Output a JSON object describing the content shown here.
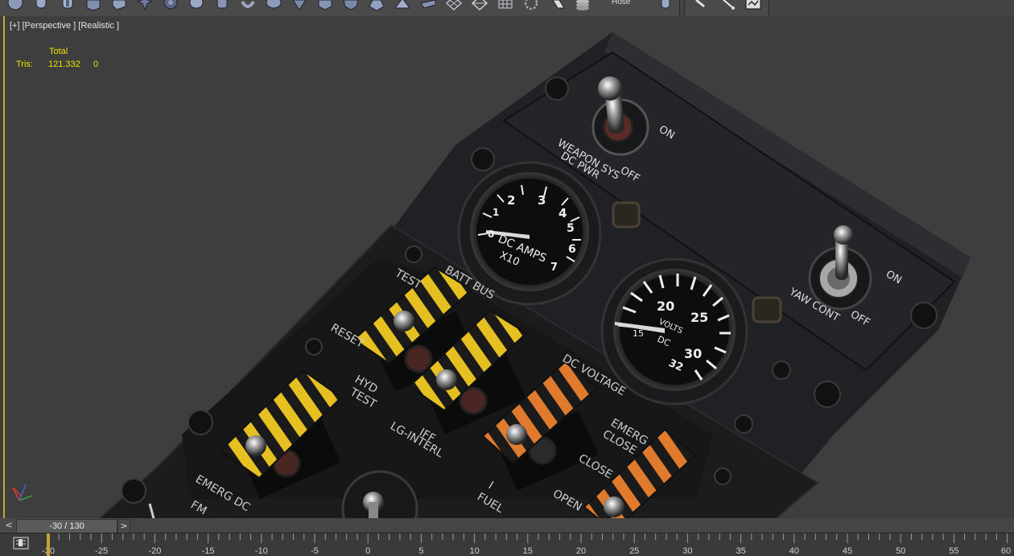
{
  "toolbar": {
    "buttons": [
      {
        "icon": "sphere-icon"
      },
      {
        "icon": "cylinder-icon"
      },
      {
        "icon": "tube-icon"
      },
      {
        "icon": "box-icon"
      },
      {
        "icon": "wedge-icon"
      },
      {
        "icon": "star-icon"
      },
      {
        "icon": "torus-knot-icon"
      },
      {
        "icon": "capsule-icon"
      },
      {
        "icon": "spring-icon"
      },
      {
        "icon": "torus-icon"
      },
      {
        "icon": "spindle-icon"
      },
      {
        "icon": "prism-icon"
      },
      {
        "icon": "hedra-icon"
      },
      {
        "icon": "gengon-icon"
      },
      {
        "icon": "cone-icon"
      },
      {
        "icon": "plane-icon"
      },
      {
        "icon": "geosphere-icon"
      },
      {
        "icon": "lattice-icon"
      },
      {
        "icon": "grid-icon"
      },
      {
        "icon": "gear-icon"
      },
      {
        "icon": "paint-icon"
      },
      {
        "icon": "layers-icon"
      }
    ],
    "hose_label": "Hose",
    "extra_buttons": [
      {
        "icon": "pin-icon"
      },
      {
        "icon": "select-icon"
      },
      {
        "icon": "wand-icon"
      },
      {
        "icon": "snapshot-icon"
      }
    ]
  },
  "viewport": {
    "label": "[+] [Perspective ] [Realistic ]",
    "stats": {
      "header": "Total",
      "tris_label": "Tris:",
      "tris_value": "121.332",
      "tris_sel": "0"
    }
  },
  "panel_text": {
    "weapon_on": "ON",
    "weapon_off": "OFF",
    "weapon_label1": "WEAPON SYS",
    "weapon_label2": "DC PWR",
    "amps_label": "DC AMPS",
    "amps_x10": "X10",
    "amps_ticks": [
      "0",
      "1",
      "2",
      "3",
      "4",
      "5",
      "6",
      "7"
    ],
    "volts_label": "VOLTS",
    "volts_dc": "DC",
    "volts_ticks": [
      "15",
      "20",
      "25",
      "30",
      "32"
    ],
    "yaw_on": "ON",
    "yaw_off": "OFF",
    "yaw_label": "YAW CONT",
    "test": "TEST",
    "batt_bus": "BATT BUS",
    "reset": "RESET",
    "hyd": "HYD",
    "hyd_test": "TEST",
    "iff": "IFF",
    "lg_interl": "LG-INTERL",
    "dc_voltage": "DC VOLTAGE",
    "emerg": "EMERG",
    "close": "CLOSE",
    "close2": "CLOSE",
    "open": "OPEN",
    "fuel": "FUEL",
    "fuel_i": "I",
    "emerg_dc": "EMERG DC",
    "fm": "FM"
  },
  "timeslider": {
    "prev": "<",
    "value": "-30 / 130",
    "next": ">"
  },
  "ruler": {
    "labels": [
      "-30",
      "-25",
      "-20",
      "-15",
      "-10",
      "-5",
      "0",
      "5",
      "10",
      "15",
      "20",
      "25",
      "30",
      "35",
      "40",
      "45",
      "50",
      "55",
      "60"
    ]
  },
  "colors": {
    "accent": "#c8a530",
    "stats": "#f2e200",
    "viewport_bg": "#3e3e3e",
    "panel": "#1e1f21"
  }
}
